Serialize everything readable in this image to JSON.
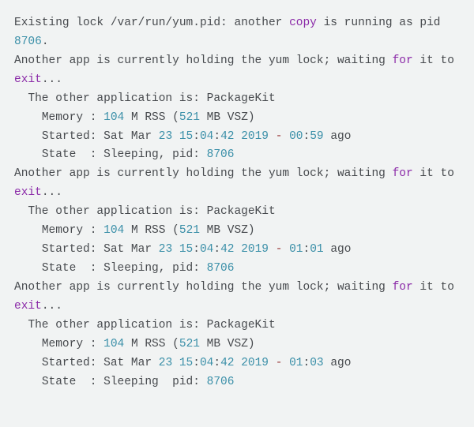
{
  "lock_file": "/var/run/yum.pid",
  "pid": "8706",
  "line_existing_1": "Existing lock /var/run/yum.pid: another ",
  "line_existing_2": " is running as pid ",
  "kw_copy": "copy",
  "punct_dot": ".",
  "wait_1": "Another app is currently holding the yum lock; waiting ",
  "kw_for": "for",
  "wait_2": " it to ",
  "kw_exit": "exit",
  "ellipsis": "...",
  "other_app_line": "  The other application is: PackageKit",
  "mem_pre": "    Memory : ",
  "mem_val": "104",
  "mem_mid": " M RSS (",
  "mem_vsz": "521",
  "mem_post": " MB VSZ)",
  "started_pre": "    Started: Sat Mar ",
  "started_day": "23",
  "started_sp": " ",
  "started_hh": "15",
  "colon": ":",
  "started_mm": "04",
  "started_ss": "42",
  "started_year": "2019",
  "dash": "-",
  "ago_1_pre": "00",
  "ago_1_post": "59",
  "ago_2_pre": "01",
  "ago_2_post": "01",
  "ago_3_pre": "01",
  "ago_3_post": "03",
  "ago_suffix": " ago",
  "state_pre": "    State  : Sleeping, pid: ",
  "state_cut_pre": "    State  : Sleeping  pid: ",
  "application": "PackageKit",
  "date_full": "Sat Mar 23 15:04:42 2019",
  "memory_rss_mb": 104,
  "memory_vsz_mb": 521
}
